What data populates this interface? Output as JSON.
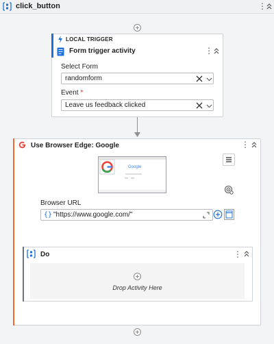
{
  "header": {
    "title": "click_button",
    "menu_glyph": "⋮",
    "sequence_icon": "sequence-icon",
    "collapse_icon": "collapse-chevrons-icon"
  },
  "trigger": {
    "section_label": "LOCAL TRIGGER",
    "title": "Form trigger activity",
    "menu_glyph": "⋮",
    "select_form_label": "Select Form",
    "select_form_value": "randomform",
    "event_label": "Event",
    "event_required_mark": "*",
    "event_value": "Leave us feedback clicked"
  },
  "browser": {
    "title": "Use Browser Edge: Google",
    "menu_glyph": "⋮",
    "thumbnail_text": "Google",
    "url_label": "Browser URL",
    "url_braces": "{}",
    "url_value": "\"https://www.google.com/\""
  },
  "do": {
    "title": "Do",
    "menu_glyph": "⋮",
    "drop_text": "Drop Activity Here"
  },
  "colors": {
    "trigger_accent": "#1e6fd9",
    "browser_accent": "#f06a2c",
    "canvas_bg": "#f3f4f6"
  }
}
